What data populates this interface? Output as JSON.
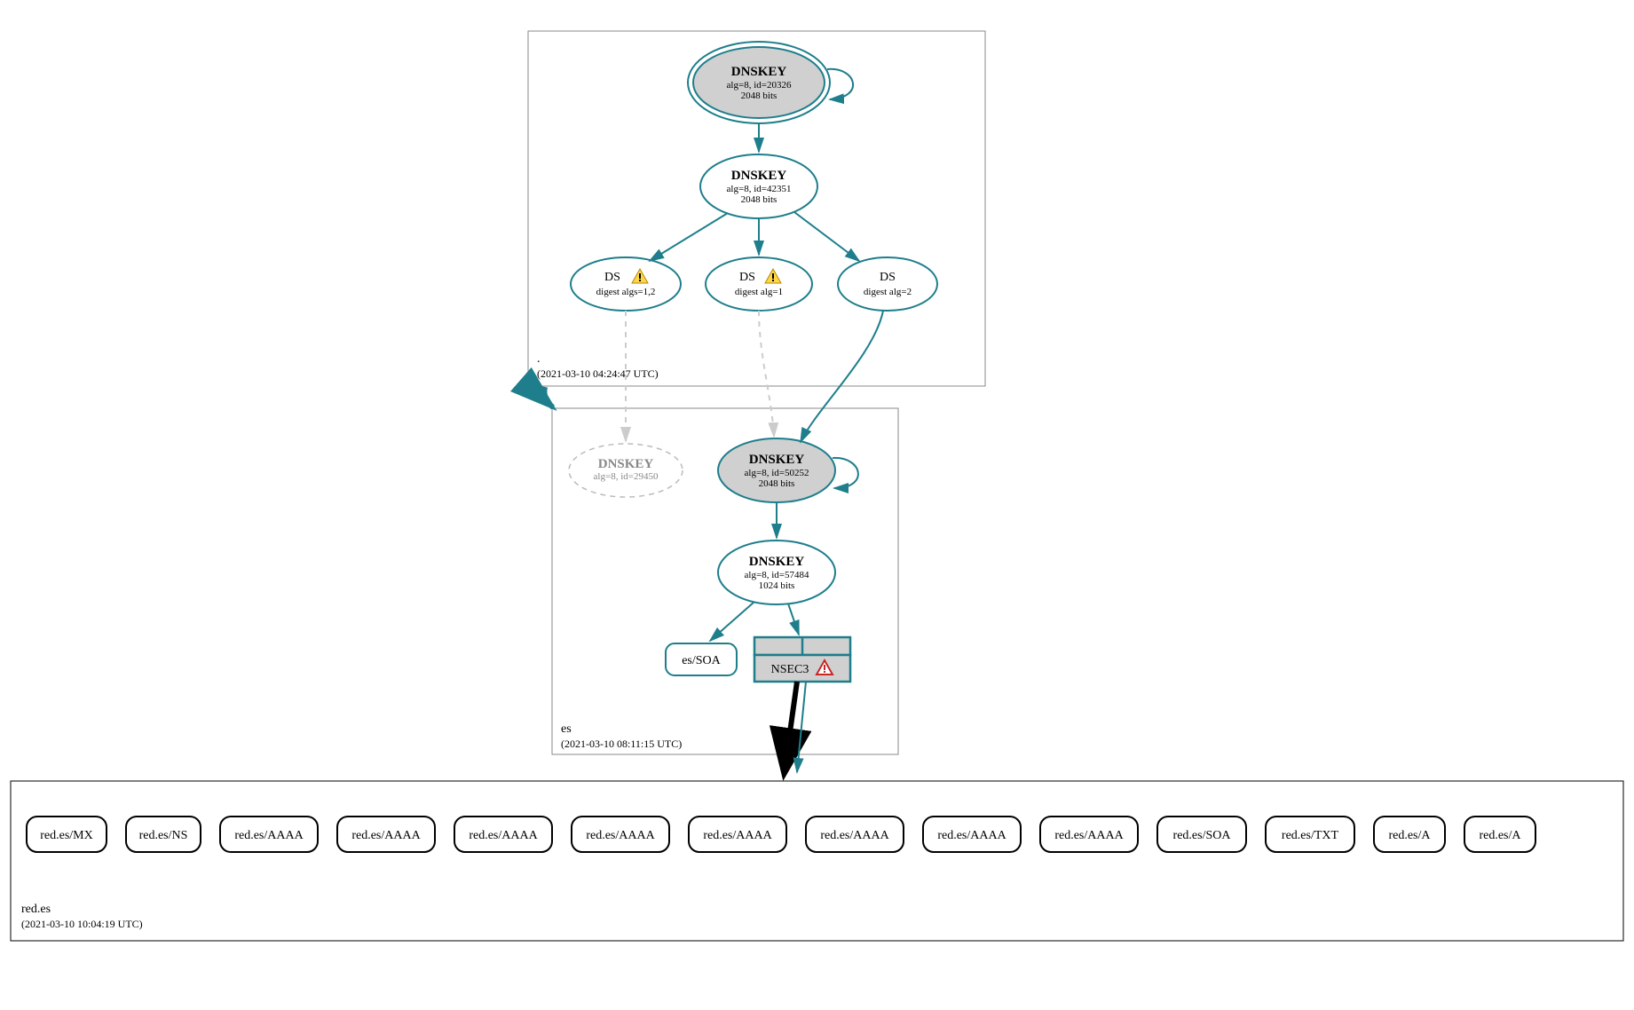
{
  "colors": {
    "accent": "#1e7e8c",
    "grey_fill": "#d0d0d0",
    "light": "#ccc"
  },
  "zones": {
    "root": {
      "name": ".",
      "timestamp": "(2021-03-10 04:24:47 UTC)"
    },
    "es": {
      "name": "es",
      "timestamp": "(2021-03-10 08:11:15 UTC)"
    },
    "redes": {
      "name": "red.es",
      "timestamp": "(2021-03-10 10:04:19 UTC)"
    }
  },
  "nodes": {
    "root_ksk": {
      "title": "DNSKEY",
      "line1": "alg=8, id=20326",
      "line2": "2048 bits"
    },
    "root_zsk": {
      "title": "DNSKEY",
      "line1": "alg=8, id=42351",
      "line2": "2048 bits"
    },
    "ds1": {
      "title": "DS",
      "line1": "digest algs=1,2",
      "warn": true
    },
    "ds2": {
      "title": "DS",
      "line1": "digest alg=1",
      "warn": true
    },
    "ds3": {
      "title": "DS",
      "line1": "digest alg=2",
      "warn": false
    },
    "es_dnskey_ghost": {
      "title": "DNSKEY",
      "line1": "alg=8, id=29450"
    },
    "es_ksk": {
      "title": "DNSKEY",
      "line1": "alg=8, id=50252",
      "line2": "2048 bits"
    },
    "es_zsk": {
      "title": "DNSKEY",
      "line1": "alg=8, id=57484",
      "line2": "1024 bits"
    },
    "es_soa": {
      "title": "es/SOA"
    },
    "nsec3": {
      "title": "NSEC3",
      "error": true
    }
  },
  "rrsets": [
    "red.es/MX",
    "red.es/NS",
    "red.es/AAAA",
    "red.es/AAAA",
    "red.es/AAAA",
    "red.es/AAAA",
    "red.es/AAAA",
    "red.es/AAAA",
    "red.es/AAAA",
    "red.es/AAAA",
    "red.es/SOA",
    "red.es/TXT",
    "red.es/A",
    "red.es/A"
  ]
}
